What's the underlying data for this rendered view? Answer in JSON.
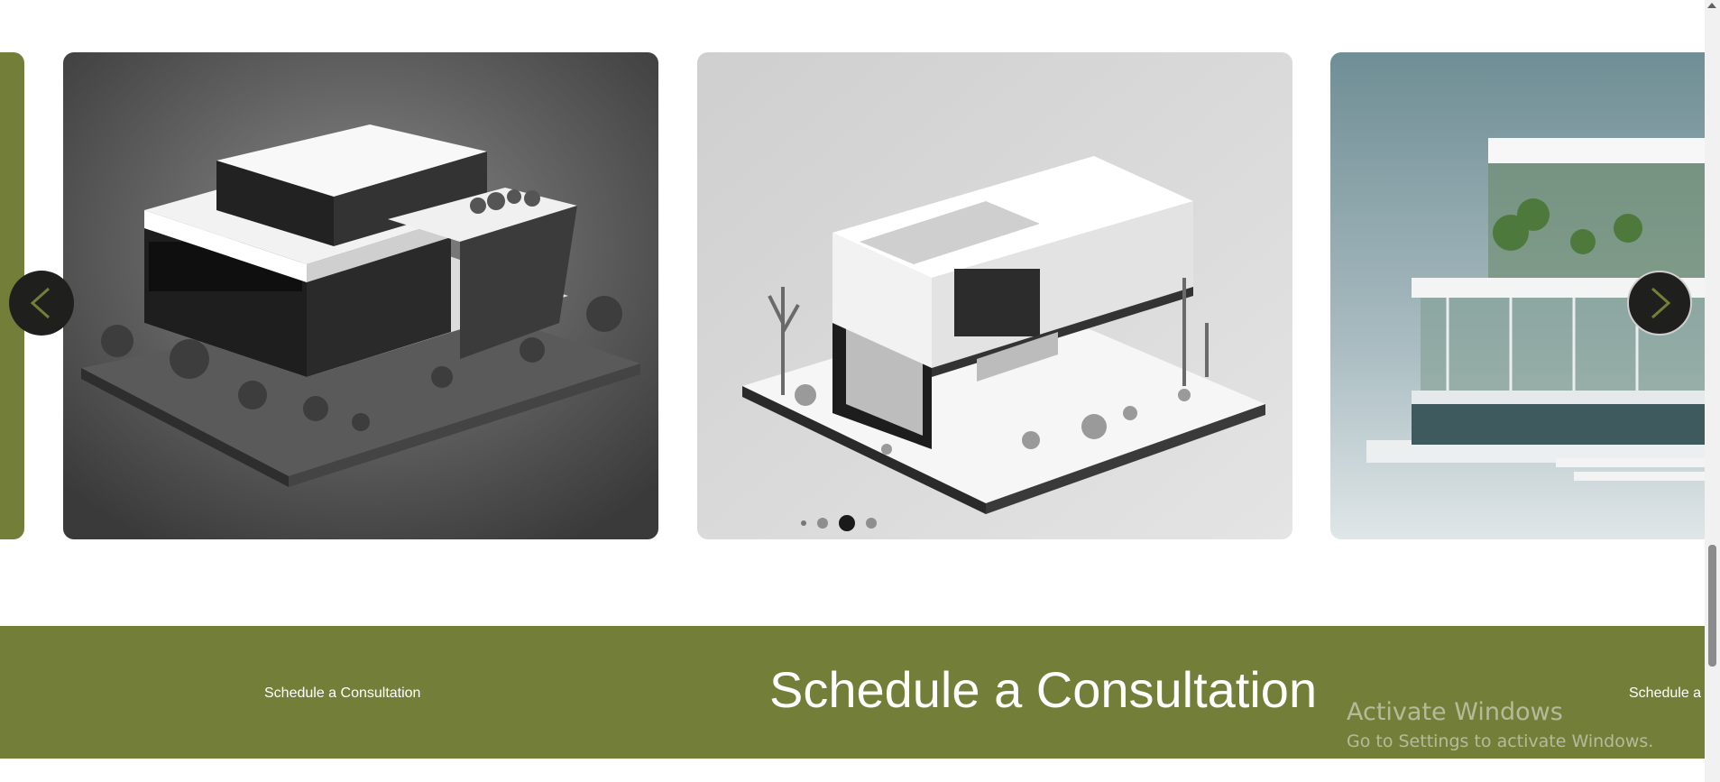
{
  "carousel": {
    "prev_icon": "chevron-left-icon",
    "next_icon": "chevron-right-icon",
    "accent_color": "#737f38",
    "slides": [
      {
        "description_icon": "building-render-dark"
      },
      {
        "description_icon": "building-render-light"
      },
      {
        "description_icon": "building-render-glass"
      }
    ],
    "active_dot": 3,
    "dot_count": 4
  },
  "consultation_band": {
    "left_label": "Schedule a Consultation",
    "title": "Schedule a Consultation",
    "right_label": "Schedule a C",
    "background": "#737f38"
  },
  "watermark": {
    "line1": "Activate Windows",
    "line2": "Go to Settings to activate Windows."
  }
}
